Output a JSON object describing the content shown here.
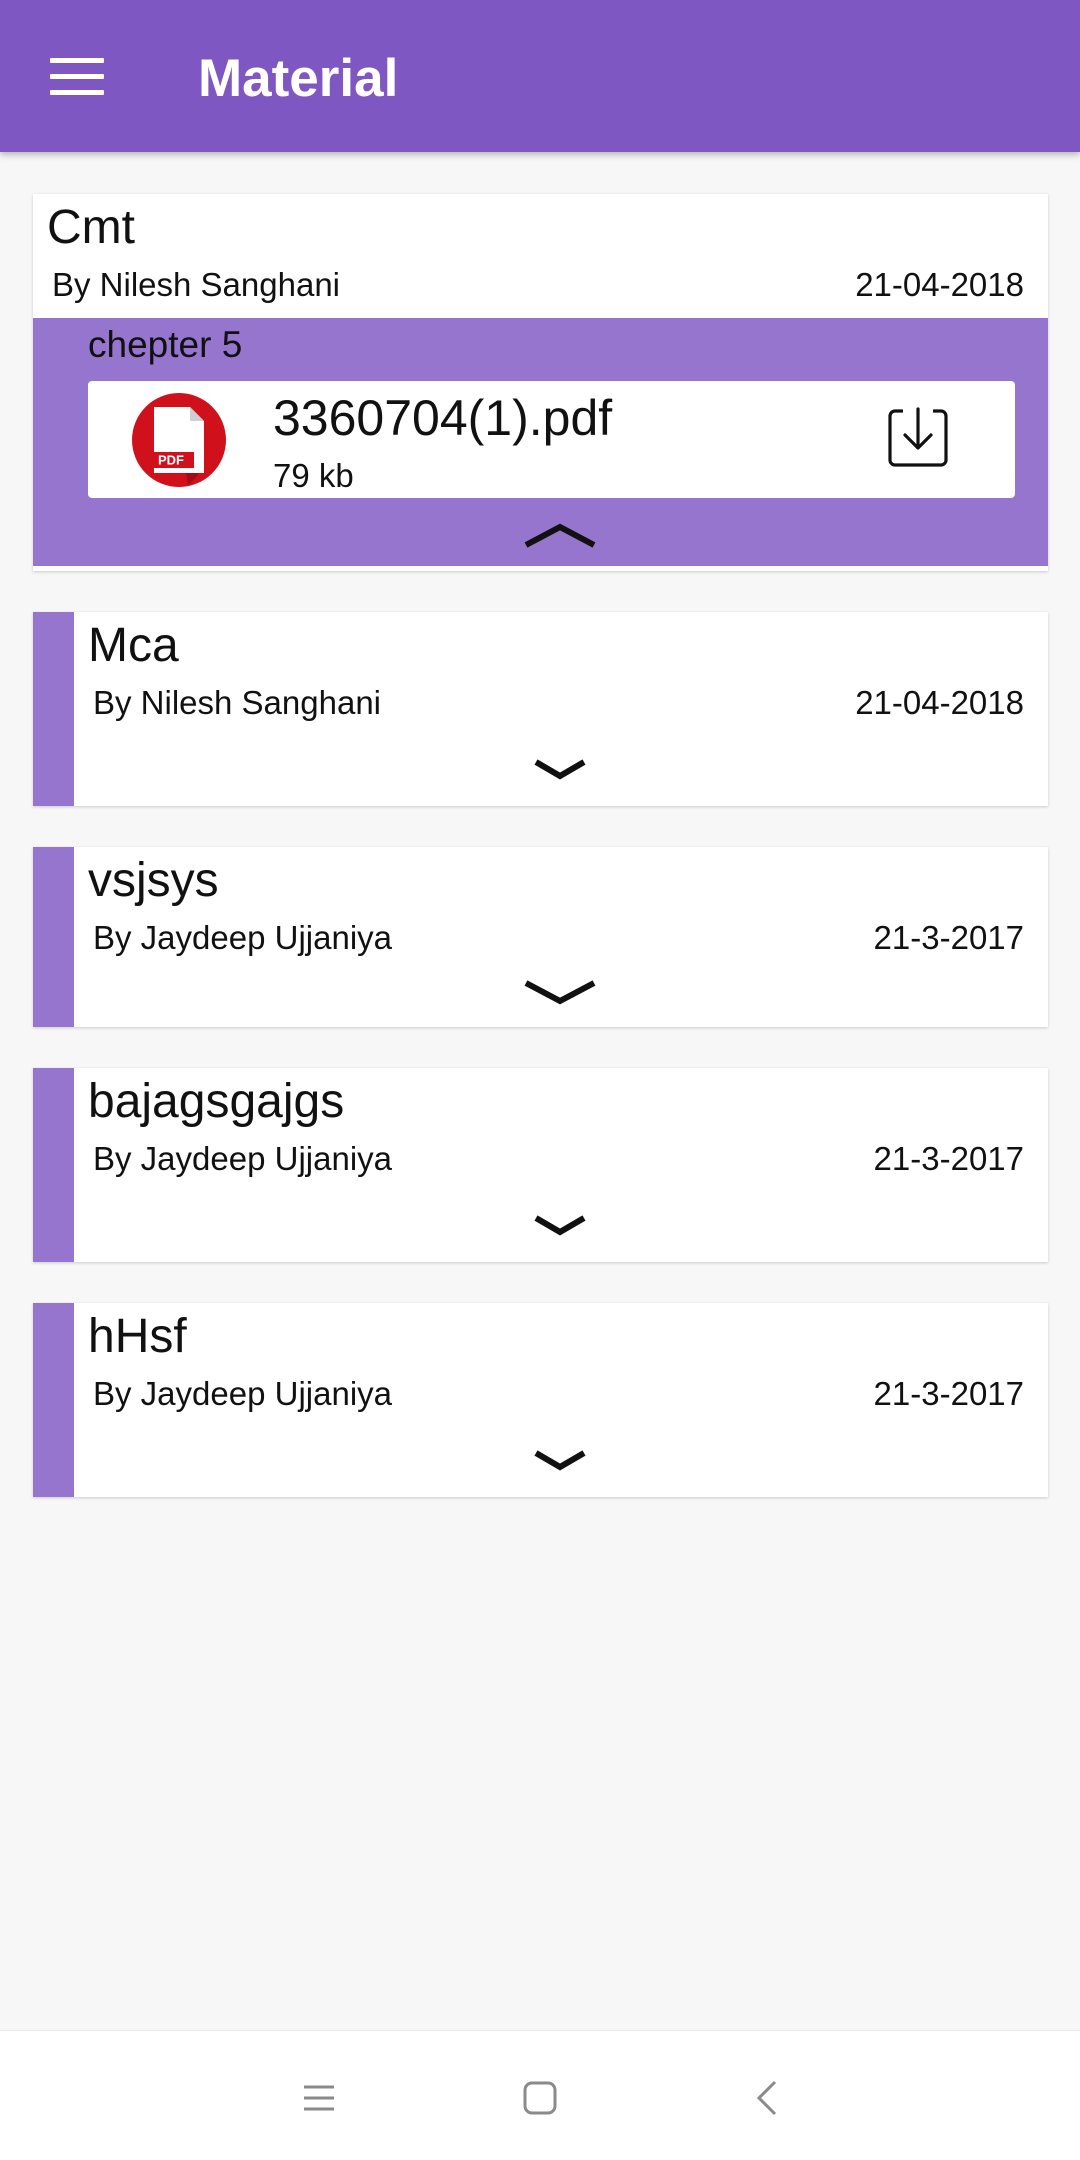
{
  "app_bar": {
    "title": "Material",
    "menu_icon": "hamburger-menu-icon",
    "color": "#7e57c2"
  },
  "accent_color": "#9575cd",
  "materials": [
    {
      "title": "Cmt",
      "author": "By Nilesh Sanghani",
      "date": "21-04-2018",
      "expanded": true,
      "section": "chepter 5",
      "file": {
        "name": "3360704(1).pdf",
        "size": "79 kb",
        "icon": "pdf-file-icon",
        "badge": "PDF",
        "action_icon": "download-icon"
      },
      "toggle_icon": "chevron-up-icon"
    },
    {
      "title": "Mca",
      "author": "By Nilesh Sanghani",
      "date": "21-04-2018",
      "expanded": false,
      "toggle_icon": "chevron-down-icon"
    },
    {
      "title": "vsjsys",
      "author": "By Jaydeep Ujjaniya",
      "date": "21-3-2017",
      "expanded": false,
      "toggle_icon": "chevron-down-icon"
    },
    {
      "title": "bajagsgajgs",
      "author": "By Jaydeep Ujjaniya",
      "date": "21-3-2017",
      "expanded": false,
      "toggle_icon": "chevron-down-icon"
    },
    {
      "title": "hHsf",
      "author": "By Jaydeep Ujjaniya",
      "date": "21-3-2017",
      "expanded": false,
      "toggle_icon": "chevron-down-icon"
    }
  ],
  "nav_bar": {
    "icons": [
      "menu-nav-icon",
      "home-square-icon",
      "back-chevron-icon"
    ]
  }
}
